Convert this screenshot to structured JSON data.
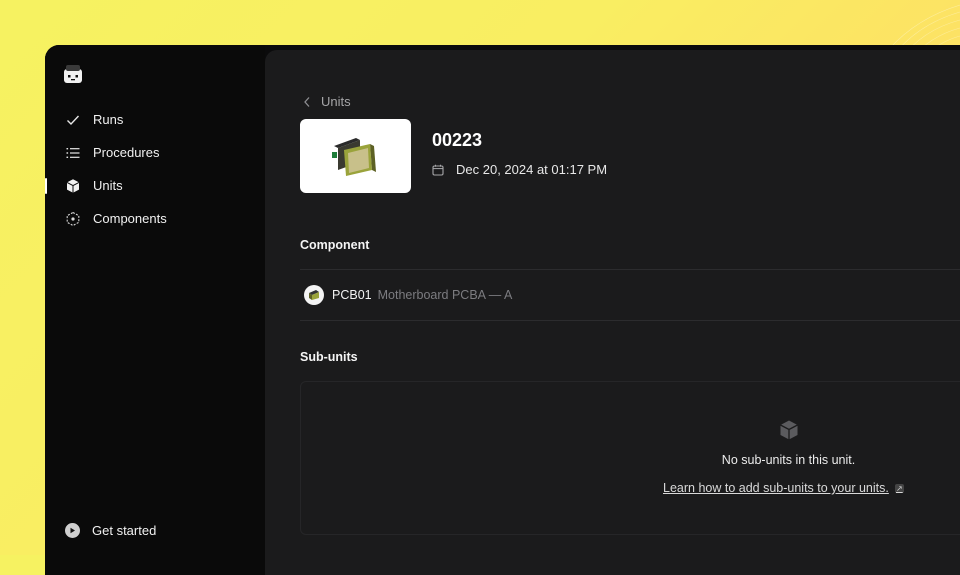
{
  "sidebar": {
    "items": [
      {
        "label": "Runs",
        "icon": "check-icon"
      },
      {
        "label": "Procedures",
        "icon": "list-icon"
      },
      {
        "label": "Units",
        "icon": "cube-icon"
      },
      {
        "label": "Components",
        "icon": "component-icon"
      }
    ],
    "footer_label": "Get started"
  },
  "breadcrumb": {
    "label": "Units"
  },
  "unit": {
    "title": "00223",
    "date": "Dec 20, 2024 at 01:17 PM"
  },
  "component_section": {
    "label": "Component",
    "code": "PCB01",
    "description": "Motherboard PCBA — A"
  },
  "subunits_section": {
    "label": "Sub-units",
    "empty_title": "No sub-units in this unit.",
    "empty_link": "Learn how to add sub-units to your units."
  },
  "colors": {
    "accent": "#f6f261",
    "sidebar_bg": "#0a0a0a",
    "main_bg": "#1b1b1c"
  }
}
